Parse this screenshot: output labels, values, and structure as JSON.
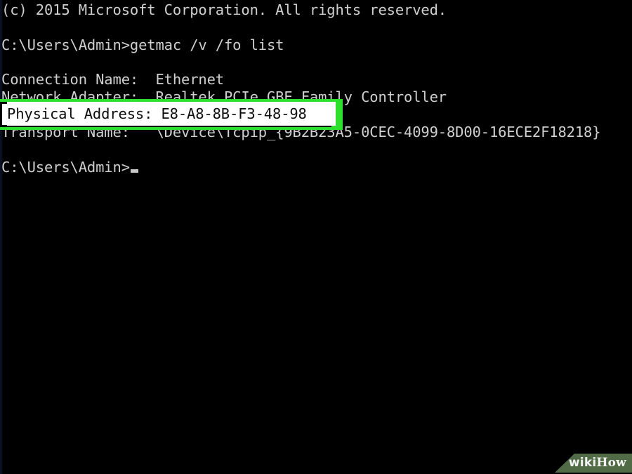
{
  "window": {
    "type": "windows-command-prompt",
    "background_color": "#000000",
    "text_color": "#cccccc"
  },
  "terminal": {
    "lines": [
      {
        "text": "(c) 2015 Microsoft Corporation. All rights reserved."
      },
      {
        "text": ""
      },
      {
        "text": "C:\\Users\\Admin>getmac /v /fo list"
      },
      {
        "text": ""
      },
      {
        "text": "Connection Name:  Ethernet"
      },
      {
        "text": "Network Adapter:  Realtek PCIe GBE Family Controller"
      },
      {
        "text": "Physical Address: E8-A8-8B-F3-48-98"
      },
      {
        "text": "Transport Name:   \\Device\\Tcpip_{9B2B23A5-0CEC-4099-8D00-16ECE2F18218}"
      },
      {
        "text": ""
      },
      {
        "text": "C:\\Users\\Admin>"
      }
    ],
    "copyright_line": "(c) 2015 Microsoft Corporation. All rights reserved.",
    "command_line": "C:\\Users\\Admin>getmac /v /fo list",
    "connection_name_line": "Connection Name:  Ethernet",
    "network_adapter_line": "Network Adapter:  Realtek PCIe GBE Family Controller",
    "physical_address_line": "Physical Address: E8-A8-8B-F3-48-98",
    "transport_name_line": "Transport Name:   \\Device\\Tcpip_{9B2B23A5-0CEC-4099-8D00-16ECE2F18218}",
    "final_prompt": "C:\\Users\\Admin>",
    "prompt_path": "C:\\Users\\Admin",
    "command": "getmac /v /fo list",
    "connection_name_value": "Ethernet",
    "network_adapter_value": "Realtek PCIe GBE Family Controller",
    "physical_address_value": "E8-A8-8B-F3-48-98",
    "transport_name_value": "\\Device\\Tcpip_{9B2B23A5-0CEC-4099-8D00-16ECE2F18218}"
  },
  "annotation": {
    "highlight_color": "#2ee02e",
    "highlight_text": "Physical Address: E8-A8-8B-F3-48-98",
    "highlight_text_color": "#0d0d0d",
    "highlight_background": "#ffffff"
  },
  "watermark": {
    "brand_first": "wiki",
    "brand_second": "How",
    "band_color": "#5b7a50"
  }
}
